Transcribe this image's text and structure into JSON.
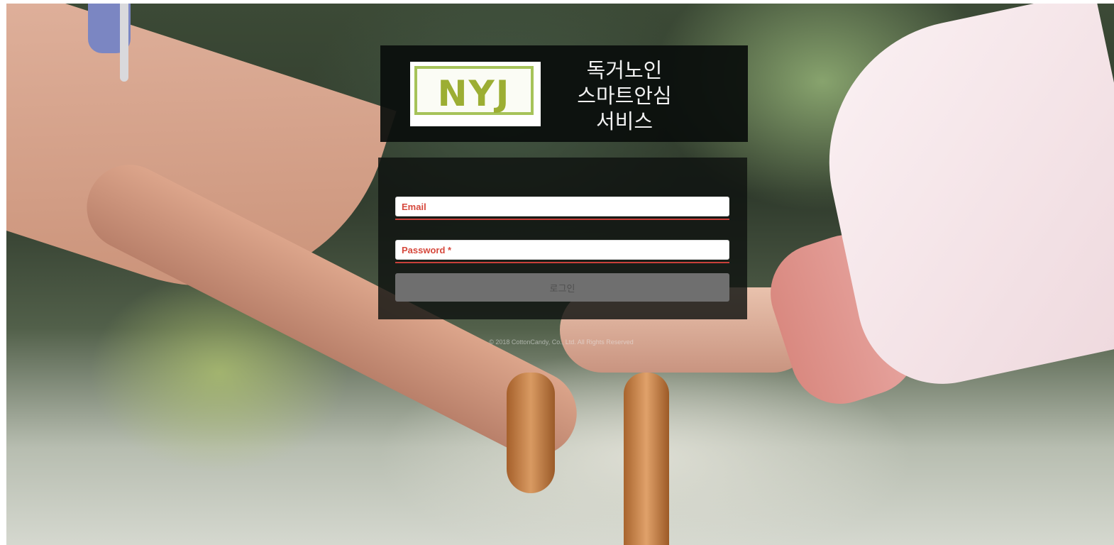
{
  "brand": {
    "logo_text": "NYJ",
    "title_lines": [
      "독거노인",
      "스마트안심",
      "서비스"
    ],
    "accent_color": "#a6c35a"
  },
  "login_form": {
    "email_placeholder": "Email",
    "password_placeholder": "Password *",
    "submit_label": "로그인",
    "error_color": "#c9403a"
  },
  "footer": {
    "copyright": "© 2018 CottonCandy, Co., Ltd. All Rights Reserved"
  }
}
